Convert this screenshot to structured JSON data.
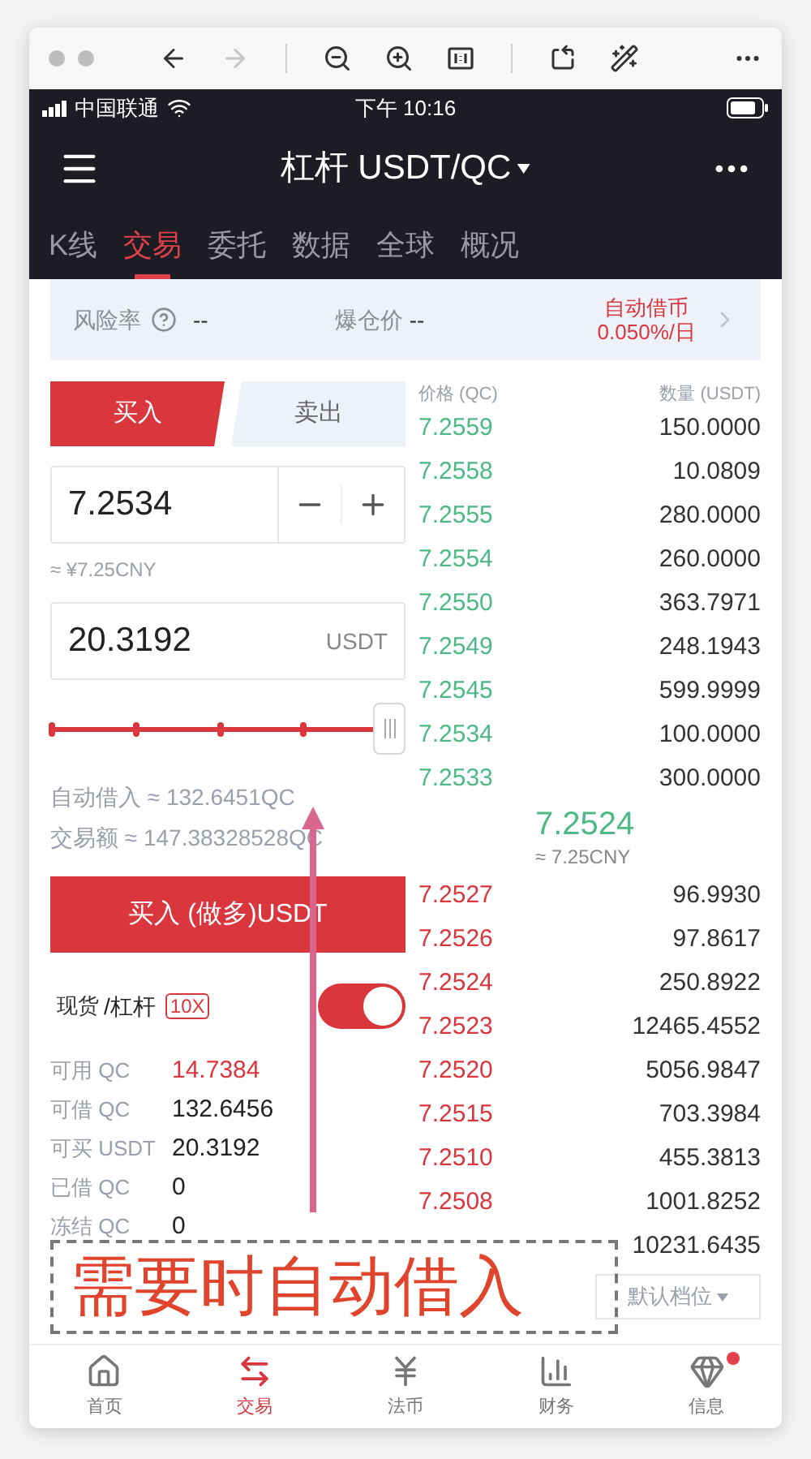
{
  "browser_toolbar": [
    {
      "kind": "back",
      "disabled": false
    },
    {
      "kind": "forward",
      "disabled": true
    },
    {
      "kind": "zoom-out",
      "disabled": false
    },
    {
      "kind": "zoom-in",
      "disabled": false
    },
    {
      "kind": "actual-size",
      "disabled": false
    },
    {
      "kind": "rotate",
      "disabled": false
    },
    {
      "kind": "enhance",
      "disabled": false
    },
    {
      "kind": "more",
      "disabled": false
    }
  ],
  "status_bar": {
    "carrier": "中国联通",
    "time": "下午 10:16"
  },
  "header": {
    "title": "杠杆 USDT/QC"
  },
  "tabs": [
    {
      "label": "K线",
      "selected": false
    },
    {
      "label": "交易",
      "selected": true
    },
    {
      "label": "委托",
      "selected": false
    },
    {
      "label": "数据",
      "selected": false
    },
    {
      "label": "全球",
      "selected": false
    },
    {
      "label": "概况",
      "selected": false
    }
  ],
  "risk_bar": {
    "risk_label": "风险率",
    "risk_value": "--",
    "liquidation_label": "爆仓价",
    "liquidation_value": "--",
    "auto_borrow_label": "自动借币",
    "auto_borrow_rate": "0.050%/日"
  },
  "order_form": {
    "sides": [
      {
        "label": "买入",
        "selected": true
      },
      {
        "label": "卖出",
        "selected": false
      }
    ],
    "price": "7.2534",
    "price_cny": "≈ ¥7.25CNY",
    "amount": "20.3192",
    "amount_unit": "USDT",
    "slider": {
      "level": 1
    },
    "auto_borrow": "自动借入 ≈ 132.6451QC",
    "trade_amount": "交易额 ≈ 147.38328528QC",
    "submit": "买入 (做多)USDT",
    "mode_spot": "现货",
    "mode_margin": "/杠杆",
    "leverage": "10X",
    "margin_on": true,
    "balances": [
      {
        "label": "可用 QC",
        "value": "14.7384",
        "color": "#d9363e"
      },
      {
        "label": "可借 QC",
        "value": "132.6456",
        "color": "#222222"
      },
      {
        "label": "可买 USDT",
        "value": "20.3192",
        "color": "#222222"
      },
      {
        "label": "已借 QC",
        "value": "0",
        "color": "#222222"
      },
      {
        "label": "冻结 QC",
        "value": "0",
        "color": "#222222"
      }
    ]
  },
  "order_book": {
    "price_header": "价格 (QC)",
    "amount_header": "数量 (USDT)",
    "asks": [
      {
        "price": "7.2559",
        "amount": "150.0000"
      },
      {
        "price": "7.2558",
        "amount": "10.0809"
      },
      {
        "price": "7.2555",
        "amount": "280.0000"
      },
      {
        "price": "7.2554",
        "amount": "260.0000"
      },
      {
        "price": "7.2550",
        "amount": "363.7971"
      },
      {
        "price": "7.2549",
        "amount": "248.1943"
      },
      {
        "price": "7.2545",
        "amount": "599.9999"
      },
      {
        "price": "7.2534",
        "amount": "100.0000"
      },
      {
        "price": "7.2533",
        "amount": "300.0000"
      }
    ],
    "last_price": "7.2524",
    "last_price_cny": "≈ 7.25CNY",
    "bids": [
      {
        "price": "7.2527",
        "amount": "96.9930"
      },
      {
        "price": "7.2526",
        "amount": "97.8617"
      },
      {
        "price": "7.2524",
        "amount": "250.8922"
      },
      {
        "price": "7.2523",
        "amount": "12465.4552"
      },
      {
        "price": "7.2520",
        "amount": "5056.9847"
      },
      {
        "price": "7.2515",
        "amount": "703.3984"
      },
      {
        "price": "7.2510",
        "amount": "455.3813"
      },
      {
        "price": "7.2508",
        "amount": "1001.8252"
      },
      {
        "amount": "10231.6435"
      }
    ],
    "depth_selector": "默认档位"
  },
  "bottom_nav": [
    {
      "kind": "home",
      "label": "首页",
      "selected": false,
      "badge": false
    },
    {
      "kind": "trade",
      "label": "交易",
      "selected": true,
      "badge": false
    },
    {
      "kind": "fiat",
      "label": "法币",
      "selected": false,
      "badge": false
    },
    {
      "kind": "finance",
      "label": "财务",
      "selected": false,
      "badge": false
    },
    {
      "kind": "info",
      "label": "信息",
      "selected": false,
      "badge": true
    }
  ],
  "annotation": {
    "text": "需要时自动借入"
  }
}
